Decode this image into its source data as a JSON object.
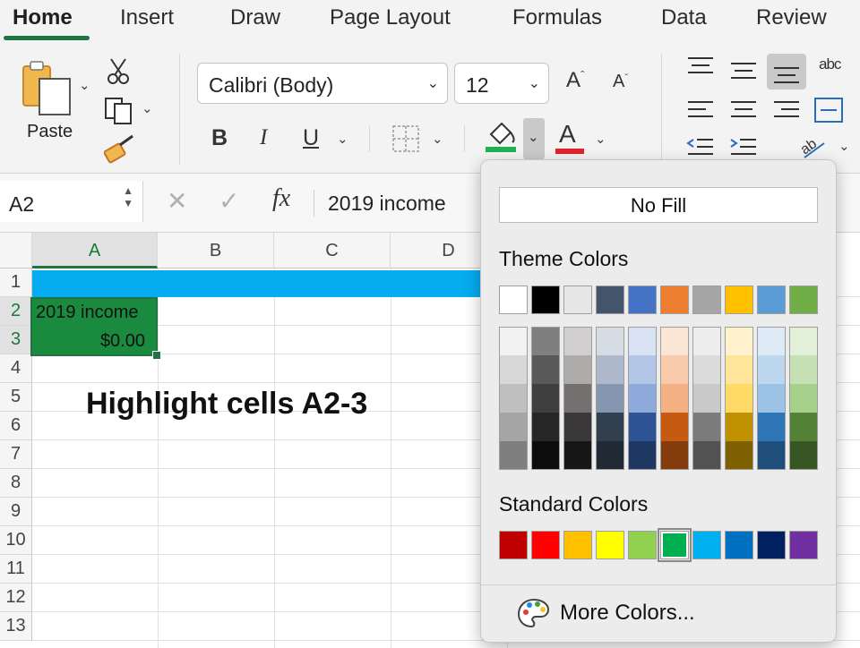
{
  "tabs": [
    "Home",
    "Insert",
    "Draw",
    "Page Layout",
    "Formulas",
    "Data",
    "Review"
  ],
  "ribbon": {
    "paste_label": "Paste",
    "font_name": "Calibri (Body)",
    "font_size": "12",
    "increase_font_glyph": "A",
    "decrease_font_glyph": "A",
    "bold_glyph": "B",
    "italic_glyph": "I",
    "underline_glyph": "U",
    "fill_color": "#1db254",
    "font_color_glyph": "A",
    "font_color": "#e3232b",
    "wrap_icon_text": "abc"
  },
  "formula_bar": {
    "name_box": "A2",
    "cancel_glyph": "✕",
    "enter_glyph": "✓",
    "fx_glyph": "fx",
    "content": "2019 income"
  },
  "sheet": {
    "columns": [
      "A",
      "B",
      "C",
      "D"
    ],
    "rows": [
      "1",
      "2",
      "3",
      "4",
      "5",
      "6",
      "7",
      "8",
      "9",
      "10",
      "11",
      "12",
      "13"
    ],
    "cells": {
      "A2": "2019 income",
      "A3": "$0.00"
    },
    "annotation": "Highlight cells A2-3",
    "row1_fill": "#05acef",
    "selection_fill": "#1a8a3f"
  },
  "fill_popup": {
    "no_fill_label": "No Fill",
    "theme_title": "Theme Colors",
    "standard_title": "Standard Colors",
    "more_colors_label": "More Colors...",
    "theme_top": [
      "#ffffff",
      "#000000",
      "#e7e6e6",
      "#44546a",
      "#4472c4",
      "#ed7d31",
      "#a5a5a5",
      "#ffc000",
      "#5b9bd5",
      "#70ad47"
    ],
    "theme_shades": [
      [
        "#f2f2f2",
        "#7f7f7f",
        "#d0cece",
        "#d6dce4",
        "#d9e2f3",
        "#fbe5d5",
        "#ededed",
        "#fff2cc",
        "#deebf6",
        "#e2efd9"
      ],
      [
        "#d8d8d8",
        "#595959",
        "#aeabab",
        "#adb9ca",
        "#b4c6e7",
        "#f7cbac",
        "#dbdbdb",
        "#fee599",
        "#bdd7ee",
        "#c5e0b3"
      ],
      [
        "#bfbfbf",
        "#3f3f3f",
        "#757070",
        "#8496b0",
        "#8eaadb",
        "#f4b183",
        "#c9c9c9",
        "#ffd965",
        "#9cc3e5",
        "#a8d08d"
      ],
      [
        "#a5a5a5",
        "#262626",
        "#3a3838",
        "#323f4f",
        "#2f5496",
        "#c55a11",
        "#7b7b7b",
        "#bf9000",
        "#2e75b5",
        "#538135"
      ],
      [
        "#7f7f7f",
        "#0c0c0c",
        "#171616",
        "#222a35",
        "#1f3864",
        "#833c0b",
        "#525252",
        "#7f6000",
        "#1e4e79",
        "#375623"
      ]
    ],
    "standard": [
      "#c00000",
      "#ff0000",
      "#ffc000",
      "#ffff00",
      "#92d050",
      "#00b050",
      "#00b0f0",
      "#0070c0",
      "#002060",
      "#7030a0"
    ],
    "standard_selected_index": 5
  }
}
